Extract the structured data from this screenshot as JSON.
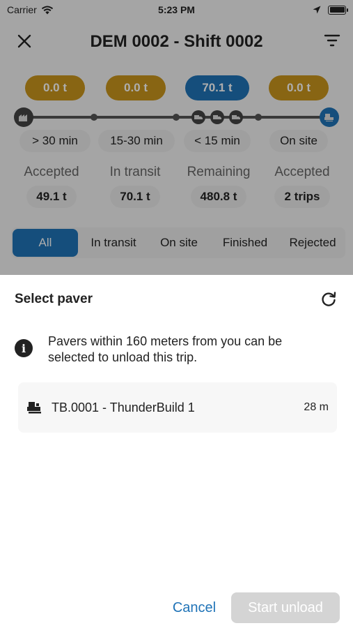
{
  "status_bar": {
    "carrier": "Carrier",
    "time": "5:23 PM"
  },
  "header": {
    "title": "DEM 0002 - Shift 0002"
  },
  "progress": {
    "pills": [
      "0.0 t",
      "0.0 t",
      "70.1 t",
      "0.0 t"
    ],
    "time_labels": [
      "> 30 min",
      "15-30 min",
      "< 15 min",
      "On site"
    ]
  },
  "stats": [
    {
      "label": "Accepted",
      "value": "49.1 t"
    },
    {
      "label": "In transit",
      "value": "70.1 t"
    },
    {
      "label": "Remaining",
      "value": "480.8 t"
    },
    {
      "label": "Accepted",
      "value": "2 trips"
    }
  ],
  "tabs": [
    "All",
    "In transit",
    "On site",
    "Finished",
    "Rejected"
  ],
  "sheet": {
    "title": "Select paver",
    "info_line1": "Pavers within 160 meters from you can be",
    "info_line2": "selected to unload this trip.",
    "paver": {
      "name": "TB.0001 - ThunderBuild 1",
      "distance": "28 m"
    },
    "cancel_label": "Cancel",
    "start_label": "Start unload"
  },
  "colors": {
    "accent": "#1f73b7",
    "amber": "#c9951c",
    "disabled": "#d4d4d4"
  }
}
